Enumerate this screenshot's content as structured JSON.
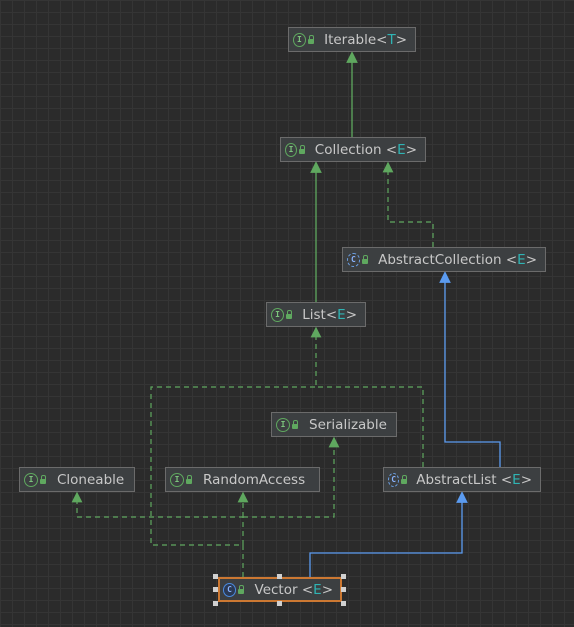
{
  "diagram": {
    "nodes": [
      {
        "id": "iterable",
        "name": "Iterable",
        "type_param": "T",
        "kind": "interface"
      },
      {
        "id": "collection",
        "name": "Collection",
        "type_param": "E",
        "kind": "interface"
      },
      {
        "id": "abstract-collection",
        "name": "AbstractCollection",
        "type_param": "E",
        "kind": "abstract-class"
      },
      {
        "id": "list",
        "name": "List",
        "type_param": "E",
        "kind": "interface"
      },
      {
        "id": "serializable",
        "name": "Serializable",
        "type_param": "",
        "kind": "interface"
      },
      {
        "id": "cloneable",
        "name": "Cloneable",
        "type_param": "",
        "kind": "interface"
      },
      {
        "id": "random-access",
        "name": "RandomAccess",
        "type_param": "",
        "kind": "interface"
      },
      {
        "id": "abstract-list",
        "name": "AbstractList",
        "type_param": "E",
        "kind": "abstract-class"
      },
      {
        "id": "vector",
        "name": "Vector",
        "type_param": "E",
        "kind": "class",
        "selected": true
      }
    ],
    "edges": [
      {
        "from": "collection",
        "to": "iterable",
        "relation": "extends"
      },
      {
        "from": "abstract-collection",
        "to": "collection",
        "relation": "implements"
      },
      {
        "from": "list",
        "to": "collection",
        "relation": "extends"
      },
      {
        "from": "abstract-list",
        "to": "abstract-collection",
        "relation": "extends"
      },
      {
        "from": "abstract-list",
        "to": "list",
        "relation": "implements"
      },
      {
        "from": "vector",
        "to": "abstract-list",
        "relation": "extends"
      },
      {
        "from": "vector",
        "to": "list",
        "relation": "implements"
      },
      {
        "from": "vector",
        "to": "cloneable",
        "relation": "implements"
      },
      {
        "from": "vector",
        "to": "random-access",
        "relation": "implements"
      },
      {
        "from": "vector",
        "to": "serializable",
        "relation": "implements"
      }
    ]
  },
  "colors": {
    "background": "#2b2b2b",
    "grid": "#353535",
    "node_fill": "#3c3f41",
    "node_border": "#6b6b6b",
    "selected_border": "#cc7832",
    "interface_edge": "#5fa85f",
    "class_edge": "#5b9bf0",
    "type_param": "#2fb4b4"
  },
  "icons": {
    "interface": "interface-icon",
    "abstract-class": "abstract-class-icon",
    "class": "class-icon",
    "visibility": "public-lock-icon"
  }
}
